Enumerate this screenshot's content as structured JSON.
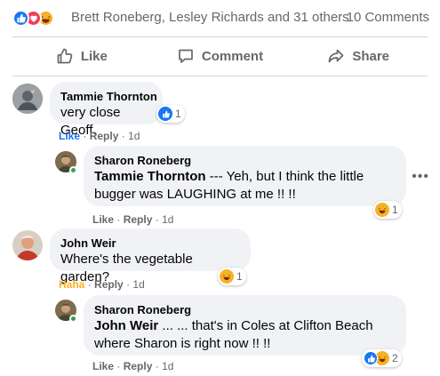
{
  "summary": {
    "names": "Brett Roneberg, Lesley Richards and 31 others",
    "comments_count": "10 Comments"
  },
  "actions": {
    "like": "Like",
    "comment": "Comment",
    "share": "Share"
  },
  "comments": [
    {
      "author": "Tammie Thornton",
      "text": "very close Geoff.",
      "like_label": "Like",
      "reply_label": "Reply",
      "time": "1d",
      "reaction_count": "1",
      "reaction_icons": [
        "like-icon"
      ]
    },
    {
      "author": "Sharon Roneberg",
      "mention": "Tammie Thornton",
      "text": " --- Yeh, but I think the little bugger was LAUGHING at me !! !!",
      "like_label": "Like",
      "reply_label": "Reply",
      "time": "1d",
      "reaction_count": "1",
      "reaction_icons": [
        "haha-icon"
      ]
    },
    {
      "author": "John Weir",
      "text": "Where's the vegetable garden?",
      "like_label": "Haha",
      "reply_label": "Reply",
      "time": "1d",
      "reaction_count": "1",
      "reaction_icons": [
        "haha-icon"
      ]
    },
    {
      "author": "Sharon Roneberg",
      "mention": "John Weir",
      "text": " ... ... that's in Coles at Clifton Beach where Sharon is right now !! !!",
      "like_label": "Like",
      "reply_label": "Reply",
      "time": "1d",
      "reaction_count": "2",
      "reaction_icons": [
        "like-icon",
        "haha-icon"
      ]
    }
  ],
  "colors": {
    "accent": "#1877f2",
    "love": "#f33e58",
    "haha": "#f7b125",
    "bubble": "#f0f2f5",
    "muted": "#65676b",
    "online": "#31a24c"
  }
}
